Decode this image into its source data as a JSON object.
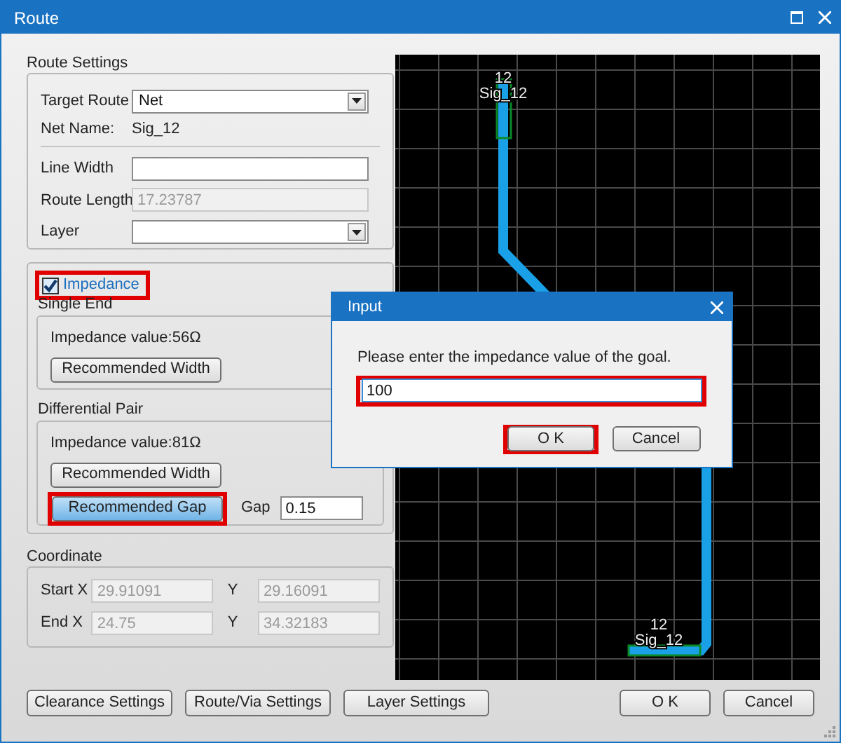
{
  "window": {
    "title": "Route"
  },
  "route_settings": {
    "title": "Route Settings",
    "rows": [
      {
        "kind": "select",
        "label": "Target Route",
        "value": "Net",
        "disabled": false
      },
      {
        "kind": "text",
        "label": "Net Name:",
        "value": "Sig_12"
      },
      {
        "kind": "divider"
      },
      {
        "kind": "input",
        "label": "Line Width",
        "disabled": false
      },
      {
        "kind": "input",
        "label": "Route Length",
        "value": "17.23787",
        "disabled": true
      },
      {
        "kind": "select",
        "label": "Layer",
        "disabled": false
      }
    ]
  },
  "impedance": {
    "label": "Impedance",
    "checked": true,
    "highlighted": true,
    "single_end": {
      "title": "Single End",
      "value_text": "Impedance value:56Ω",
      "buttons": [
        {
          "label": "Recommended Width",
          "pressed": false,
          "highlighted": false
        }
      ]
    },
    "differential_pair": {
      "title": "Differential Pair",
      "value_text": "Impedance value:81Ω",
      "buttons": [
        {
          "label": "Recommended Width",
          "pressed": false,
          "highlighted": false
        },
        {
          "label": "Recommended Gap",
          "pressed": true,
          "highlighted": true
        }
      ],
      "gap": {
        "label": "Gap",
        "value": "0.15"
      }
    }
  },
  "coordinate": {
    "title": "Coordinate",
    "rows": [
      {
        "label": "Start X",
        "value": "29.91091",
        "y_label": "Y",
        "y_value": "29.16091",
        "disabled": true
      },
      {
        "label": "End X",
        "value": "24.75",
        "y_label": "Y",
        "y_value": "34.32183",
        "disabled": true
      }
    ]
  },
  "canvas": {
    "labels": [
      {
        "number": "12",
        "name": "Sig_12"
      },
      {
        "number": "12",
        "name": "Sig_12"
      }
    ]
  },
  "bottom_left_buttons": [
    {
      "label": "Clearance Settings"
    },
    {
      "label": "Route/Via Settings"
    },
    {
      "label": "Layer Settings"
    }
  ],
  "bottom_right_buttons": [
    {
      "label": "O K"
    },
    {
      "label": "Cancel"
    }
  ],
  "dialog": {
    "title": "Input",
    "message": "Please enter the impedance value of the goal.",
    "value": "100",
    "highlighted": true,
    "buttons": [
      {
        "label": "O K",
        "highlighted": true
      },
      {
        "label": "Cancel",
        "highlighted": false
      }
    ]
  }
}
